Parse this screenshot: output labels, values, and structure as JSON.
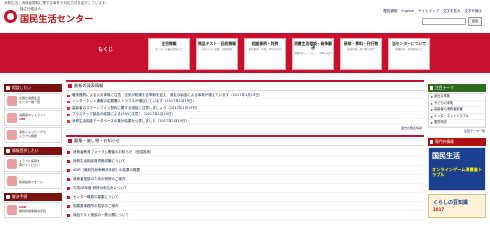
{
  "header": {
    "topline": "消費生活・消費者問題に関する事件や対応方法を紹介しています。",
    "org_small": "独立行政法人",
    "org_name": "国民生活センター",
    "util_links": [
      "閲覧補助",
      "English",
      "サイトマップ",
      "文字を拡大",
      "文字を縮小"
    ],
    "search_placeholder": "",
    "search_button": "検索"
  },
  "nav": {
    "label": "もくじ",
    "items": [
      {
        "title": "注目情報",
        "sub": "センターの最新情報など"
      },
      {
        "title": "商品テスト・回収情報",
        "sub": "商品テスト結果、回収情報"
      },
      {
        "title": "相談事例・判例",
        "sub": "相談事例・判例、ADRの状況"
      },
      {
        "title": "消費生活相談・紛争解決",
        "sub": "消費者ホットライン、ADRの紹介"
      },
      {
        "title": "研修・資料・刊行物",
        "sub": "研修情報、刊行物の紹介"
      },
      {
        "title": "当センターについて",
        "sub": "組織案内・採用情報など"
      }
    ]
  },
  "left": {
    "sec1": {
      "title": "相談したい",
      "boxes": [
        {
          "line1": "全国の消費生活",
          "line2": "センター等一覧"
        },
        {
          "line1": "消費者ホットライン",
          "line2": "188"
        },
        {
          "line1": "海外ショッピングの",
          "line2": "トラブル相談"
        }
      ]
    },
    "sec2": {
      "title": "情報提供したい",
      "boxes": [
        {
          "line1": "トラブル情報を",
          "line2": "寄せてください"
        },
        {
          "line1": "",
          "line2": "情報提供フォーム"
        }
      ]
    },
    "sec3": {
      "title": "解決手続",
      "boxes": [
        {
          "line1": "ADR",
          "line2": "裁判外紛争解決手続"
        }
      ]
    }
  },
  "news": {
    "title": "最新の発表情報",
    "items": [
      "暖房器具による火災事故に注意　空気が乾燥する季節を迎え、身近な製品による事故が増えています（2017年1月19日）",
      "インターネット通販の定期購入トラブルが増加しています（2017年1月19日）",
      "高齢者のスマートフォン契約に関する相談に注意しましょう（2017年1月19日）",
      "プラスチック製品の破損によるけがに注意！（2017年1月19日）",
      "消費生活相談データベースの集計結果を公表しました（2017年1月19日）"
    ],
    "dates": "過去の発表情報"
  },
  "events": {
    "title": "募集・催し物・お知らせ",
    "items": [
      "消費者教育フォーラム開催のお知らせ（全国各地）",
      "消費生活相談員資格試験について",
      "ADR（裁判外紛争解決手続）の結果の概要",
      "消費者相談のための研修のご案内",
      "平成28年度 研修の申込みについて",
      "センター職員の募集について",
      "相模原事務所の見学のご案内",
      "商品テスト施設の一般公開について"
    ]
  },
  "right": {
    "theme_title": "注目テーマ",
    "themes": [
      "身近な事故",
      "子どもの事故",
      "高齢者の消費者被害",
      "インターネットトラブル",
      "悪質商法"
    ],
    "more": "注目テーマ一覧",
    "mag_title": "専門外情報",
    "banner1_title": "国民生活",
    "banner1_sub": "オンラインゲーム消費者トラブル",
    "banner2_title": "くらしの豆知識",
    "banner2_year": "2017"
  }
}
